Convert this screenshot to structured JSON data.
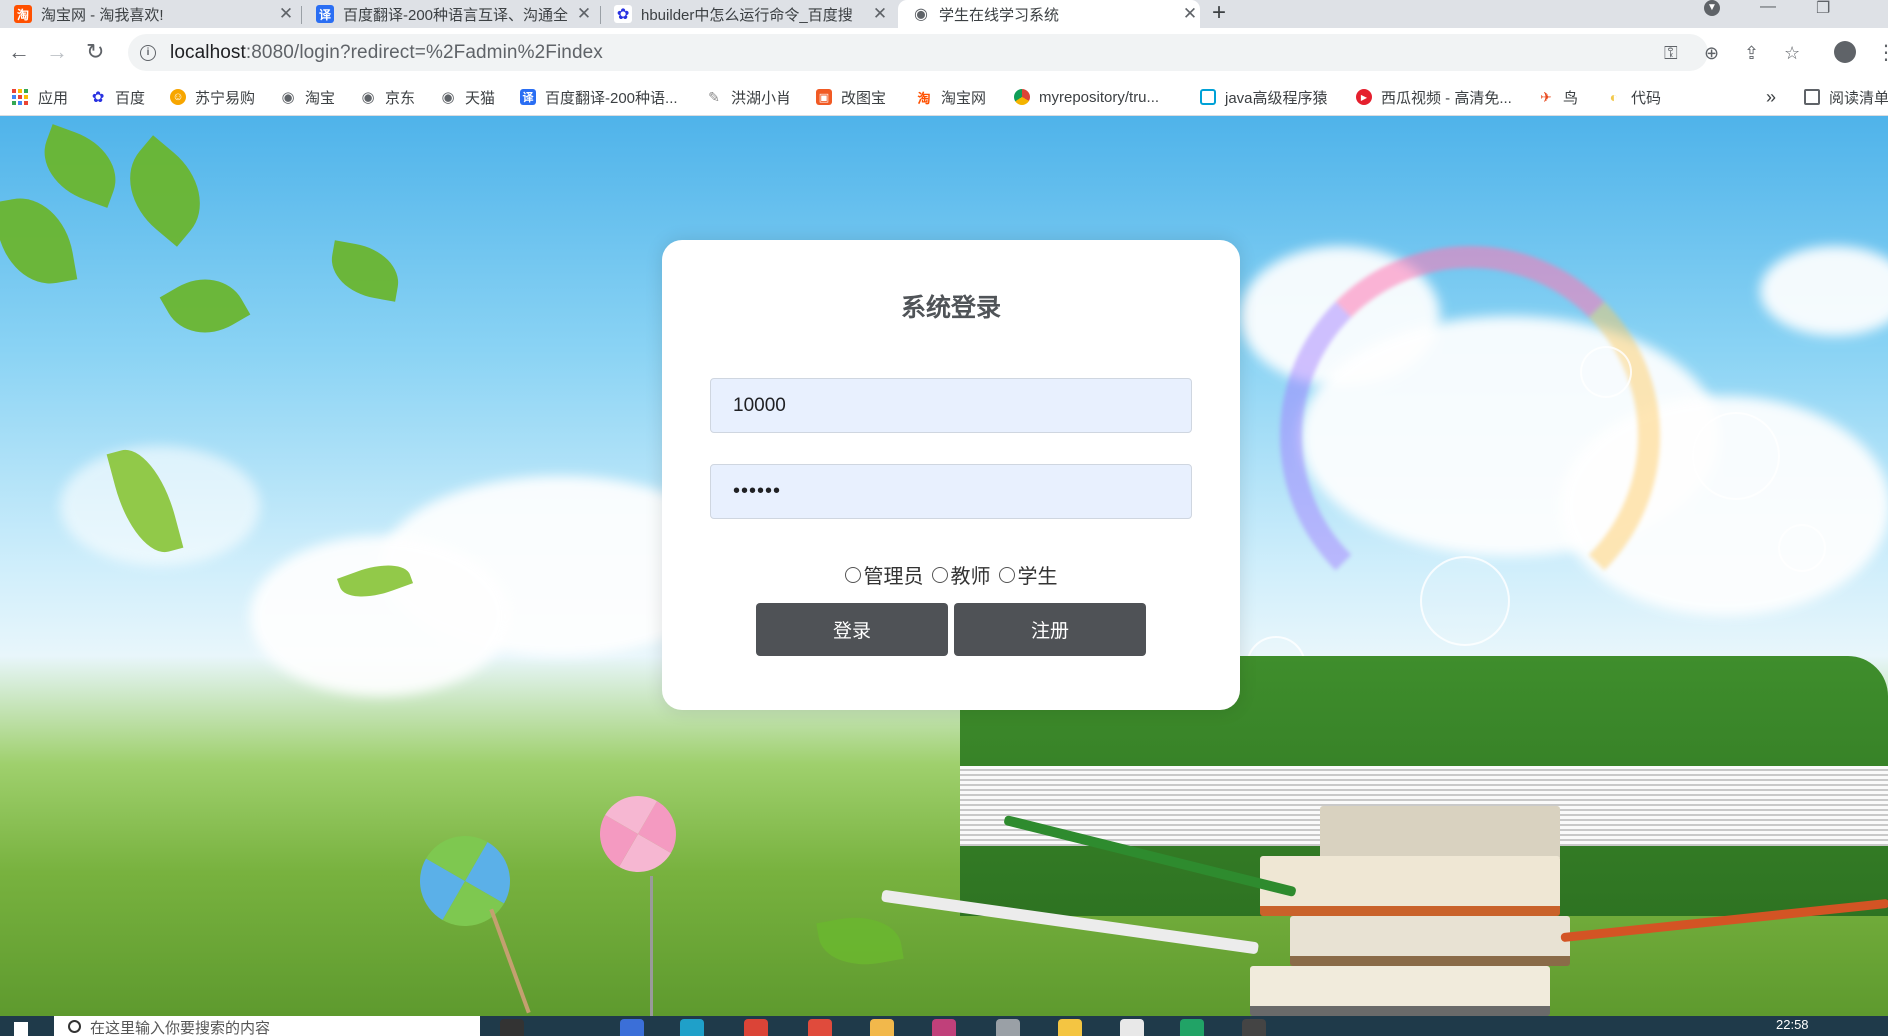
{
  "tabs": [
    {
      "title": "淘宝网 - 淘我喜欢!",
      "icon": "taobao-icon",
      "color": "#ff5000",
      "glyph": "淘"
    },
    {
      "title": "百度翻译-200种语言互译、沟通全",
      "icon": "baidu-translate-icon",
      "color": "#2a6ef3",
      "glyph": "译"
    },
    {
      "title": "hbuilder中怎么运行命令_百度搜",
      "icon": "baidu-paw-icon",
      "color": "#2932e1",
      "glyph": "✿"
    },
    {
      "title": "学生在线学习系统",
      "icon": "globe-icon",
      "color": "#5f6368",
      "glyph": "◉"
    }
  ],
  "address": {
    "host": "localhost",
    "rest": ":8080/login?redirect=%2Fadmin%2Findex"
  },
  "bookmarks": [
    {
      "label": "应用",
      "icon": "apps-grid-icon"
    },
    {
      "label": "百度",
      "icon": "baidu-paw-icon",
      "color": "#2932e1",
      "glyph": "✿"
    },
    {
      "label": "苏宁易购",
      "icon": "suning-icon",
      "color": "#f7a600",
      "glyph": "☺"
    },
    {
      "label": "淘宝",
      "icon": "globe-icon",
      "color": "#5f6368",
      "glyph": "◉"
    },
    {
      "label": "京东",
      "icon": "globe-icon",
      "color": "#5f6368",
      "glyph": "◉"
    },
    {
      "label": "天猫",
      "icon": "globe-icon",
      "color": "#5f6368",
      "glyph": "◉"
    },
    {
      "label": "百度翻译-200种语...",
      "icon": "baidu-translate-icon",
      "color": "#2a6ef3",
      "glyph": "译"
    },
    {
      "label": "洪湖小肖",
      "icon": "bird-icon",
      "color": "#8a8a8a",
      "glyph": "✎"
    },
    {
      "label": "改图宝",
      "icon": "gaitubao-icon",
      "color": "#f15a24",
      "glyph": "▣"
    },
    {
      "label": "淘宝网",
      "icon": "taobao-icon",
      "color": "#ff5000",
      "glyph": "淘"
    },
    {
      "label": "myrepository/tru...",
      "icon": "chrome-icon",
      "color": "#db4437",
      "glyph": "◎"
    },
    {
      "label": "java高级程序猿",
      "icon": "bilibili-icon",
      "color": "#00a1d6",
      "glyph": "▭"
    },
    {
      "label": "西瓜视频 - 高清免...",
      "icon": "xigua-icon",
      "color": "#e5202e",
      "glyph": "▶"
    },
    {
      "label": "鸟",
      "icon": "bird-icon",
      "color": "#e84a1f",
      "glyph": "✈"
    },
    {
      "label": "代码",
      "icon": "folder-icon",
      "color": "#f2c94c",
      "glyph": "◐"
    }
  ],
  "bookmarks_more": "»",
  "reading_list": "阅读清单",
  "login": {
    "title": "系统登录",
    "username": "10000",
    "password": "••••••",
    "roles": [
      "管理员",
      "教师",
      "学生"
    ],
    "login_button": "登录",
    "register_button": "注册"
  },
  "taskbar": {
    "search_placeholder": "在这里输入你要搜索的内容",
    "time": "22:58"
  }
}
